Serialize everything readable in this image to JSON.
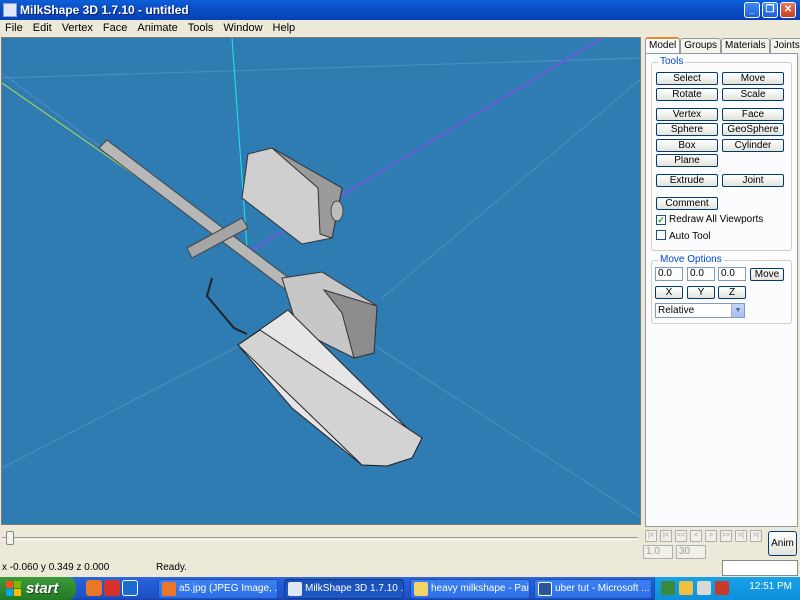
{
  "window": {
    "title": "MilkShape 3D 1.7.10 - untitled"
  },
  "menu": [
    "File",
    "Edit",
    "Vertex",
    "Face",
    "Animate",
    "Tools",
    "Window",
    "Help"
  ],
  "panel": {
    "tabs": [
      "Model",
      "Groups",
      "Materials",
      "Joints"
    ],
    "active_tab": "Model",
    "tools_label": "Tools",
    "tools": {
      "select": "Select",
      "move": "Move",
      "rotate": "Rotate",
      "scale": "Scale",
      "vertex": "Vertex",
      "face": "Face",
      "sphere": "Sphere",
      "geosphere": "GeoSphere",
      "box": "Box",
      "cylinder": "Cylinder",
      "plane": "Plane",
      "extrude": "Extrude",
      "joint": "Joint",
      "comment": "Comment"
    },
    "redraw_all_viewports": {
      "label": "Redraw All Viewports",
      "checked": true
    },
    "auto_tool": {
      "label": "Auto Tool",
      "checked": false
    },
    "move_options": {
      "label": "Move Options",
      "x": "0.0",
      "y": "0.0",
      "z": "0.0",
      "move_button": "Move",
      "axis_x": "X",
      "axis_y": "Y",
      "axis_z": "Z",
      "mode": "Relative"
    }
  },
  "animation": {
    "start_frame": "1.0",
    "end_frame": "30",
    "anim_button": "Anim"
  },
  "status": {
    "coords": "x -0.060 y 0.349 z 0.000",
    "text": "Ready."
  },
  "taskbar": {
    "start": "start",
    "tasks": [
      {
        "label": "a5.jpg (JPEG Image, ...",
        "active": false
      },
      {
        "label": "MilkShape 3D 1.7.10 ...",
        "active": true
      },
      {
        "label": "heavy milkshape - Paint",
        "active": false
      },
      {
        "label": "uber tut - Microsoft ...",
        "active": false
      }
    ],
    "clock": "12:51 PM"
  }
}
